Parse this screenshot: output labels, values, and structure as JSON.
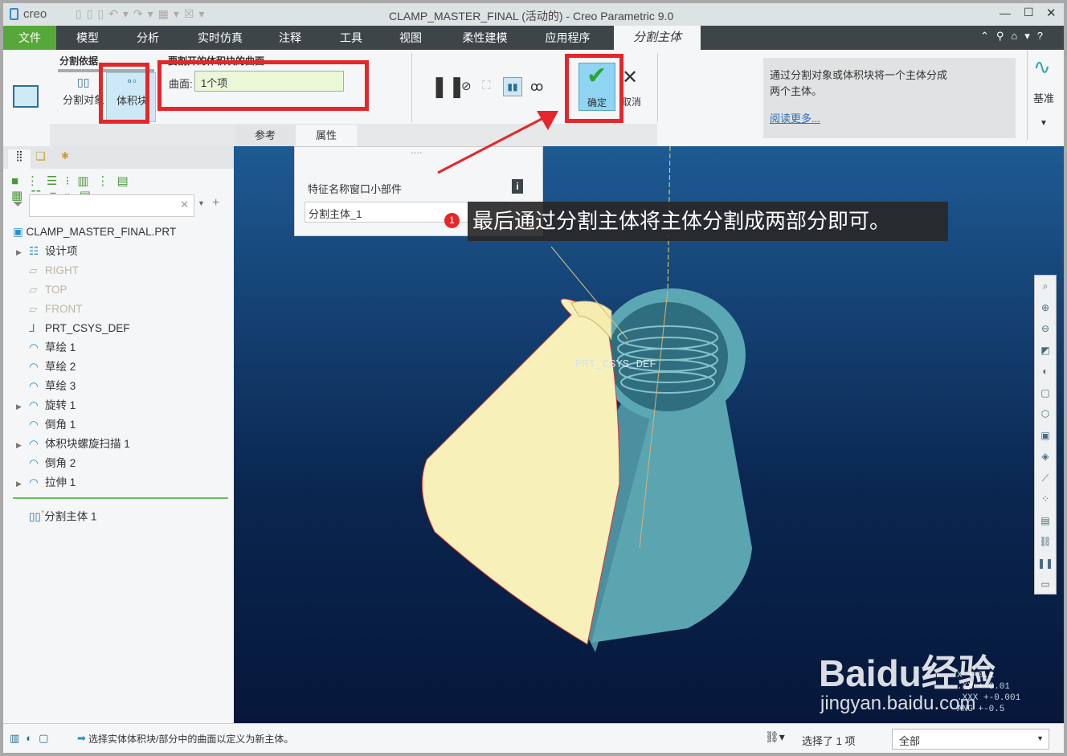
{
  "app": {
    "logo": "creo",
    "title": "CLAMP_MASTER_FINAL (活动的) - Creo Parametric 9.0"
  },
  "menu": {
    "tabs": [
      "文件",
      "模型",
      "分析",
      "实时仿真",
      "注释",
      "工具",
      "视图",
      "柔性建模",
      "应用程序",
      "分割主体"
    ],
    "active": "分割主体"
  },
  "ribbon": {
    "group_split_by": "分割依据",
    "split_object": "分割对象",
    "volume_block": "体积块",
    "surfaces_label": "要割开的体积块的曲面",
    "surface_field_label": "曲面:",
    "surface_field_value": "1个项",
    "ok": "确定",
    "cancel": "取消",
    "subtabs": [
      "参考",
      "属性"
    ],
    "help_text_1": "通过分割对象或体积块将一个主体分成",
    "help_text_2": "两个主体。",
    "read_more": "阅读更多...",
    "datum": "基准"
  },
  "properties_panel": {
    "label": "特征名称窗口小部件",
    "name_value": "分割主体_1",
    "info_icon": "i"
  },
  "annotation": {
    "number": "1",
    "text": "最后通过分割主体将主体分割成两部分即可。",
    "highlight_color": "#e5262a"
  },
  "tree": {
    "root": "CLAMP_MASTER_FINAL.PRT",
    "items": [
      {
        "label": "设计项",
        "expand": true,
        "dim": false
      },
      {
        "label": "RIGHT",
        "expand": false,
        "dim": true
      },
      {
        "label": "TOP",
        "expand": false,
        "dim": true
      },
      {
        "label": "FRONT",
        "expand": false,
        "dim": true
      },
      {
        "label": "PRT_CSYS_DEF",
        "expand": false,
        "dim": false
      },
      {
        "label": "草绘 1",
        "expand": false,
        "dim": false
      },
      {
        "label": "草绘 2",
        "expand": false,
        "dim": false
      },
      {
        "label": "草绘 3",
        "expand": false,
        "dim": false
      },
      {
        "label": "旋转 1",
        "expand": true,
        "dim": false
      },
      {
        "label": "倒角 1",
        "expand": false,
        "dim": false
      },
      {
        "label": "体积块螺旋扫描 1",
        "expand": true,
        "dim": false
      },
      {
        "label": "倒角 2",
        "expand": false,
        "dim": false
      },
      {
        "label": "拉伸 1",
        "expand": true,
        "dim": false
      }
    ],
    "new_feature": "分割主体 1"
  },
  "viewport": {
    "csys_label": "PRT_CSYS_DEF",
    "tolerances": [
      "X  +-0.1",
      ".XX  +-0.01",
      ".XXX  +-0.001",
      "ANG  +-0.5"
    ],
    "watermark": "Baidu经验",
    "watermark_url": "jingyan.baidu.com"
  },
  "status": {
    "message": "选择实体体积块/部分中的曲面以定义为新主体。",
    "selected": "选择了 1 项",
    "filter": "全部"
  }
}
